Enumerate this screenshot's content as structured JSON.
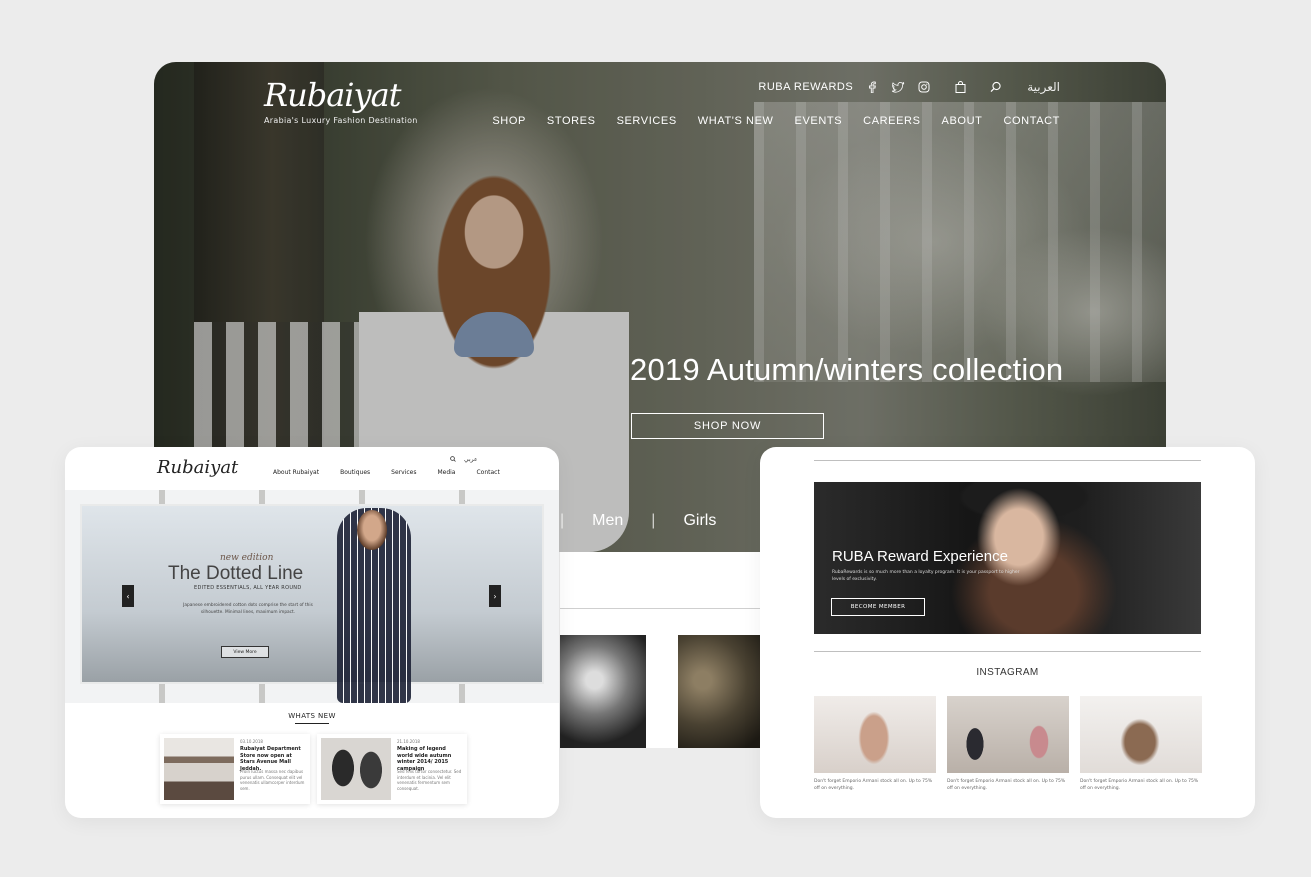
{
  "main": {
    "logo": "Rubaiyat",
    "tagline": "Arabia's Luxury Fashion Destination",
    "rewards": "RUBA REWARDS",
    "arabic": "العربية",
    "nav": [
      "SHOP",
      "STORES",
      "SERVICES",
      "WHAT'S NEW",
      "EVENTS",
      "CAREERS",
      "ABOUT",
      "CONTACT"
    ],
    "hero_title": "2019 Autumn/winters collection",
    "shop_now": "SHOP NOW",
    "categories": [
      "Men",
      "Girls"
    ]
  },
  "left": {
    "logo": "Rubaiyat",
    "nav": [
      "About Rubaiyat",
      "Boutiques",
      "Services",
      "Media",
      "Contact"
    ],
    "lang": "عربي",
    "edition": "new edition",
    "title": "The Dotted Line",
    "subtitle": "EDITED ESSENTIALS, ALL YEAR ROUND",
    "desc": "Japanese embroidered cotton dots comprise the start of this silhouette. Minimal lines, maximum impact.",
    "view_more": "View More",
    "whats_new": "WHATS NEW",
    "news": [
      {
        "date": "03.10.2018",
        "title": "Rubaiyat Department Store now open at Stars Avenue Mall Jeddah.",
        "body": "Proin luctus massa nec dapibus purus ullam. Consequat elit vel venenatis ullamcorper interdum sem."
      },
      {
        "date": "21.10.2018",
        "title": "Making of legend world wide autumn winter 2014/ 2015 campaign",
        "body": "Sed felis tortor consectetur. Sed interdum et lacinia. Vel elit venenatis fermentum sem consequat."
      }
    ]
  },
  "right": {
    "banner_title": "RUBA Reward Experience",
    "banner_desc": "RubaRewards is so much more than a loyalty program. It is your passport to higher levels of exclusivity.",
    "become_member": "BECOME MEMBER",
    "instagram": "INSTAGRAM",
    "captions": [
      "Don't forget Emporio Armani stock all on. Up to 75% off on everything.",
      "Don't forget Emporio Armani stock all on. Up to 75% off on everything.",
      "Don't forget Emporio Armani stock all on. Up to 75% off on everything."
    ]
  },
  "icons": [
    "facebook-icon",
    "twitter-icon",
    "instagram-icon",
    "bag-icon",
    "search-icon",
    "chevron-left-icon",
    "chevron-right-icon"
  ],
  "colors": {
    "background": "#ececec",
    "card": "#ffffff",
    "text_dark": "#222222",
    "hero_text": "#ffffff"
  }
}
